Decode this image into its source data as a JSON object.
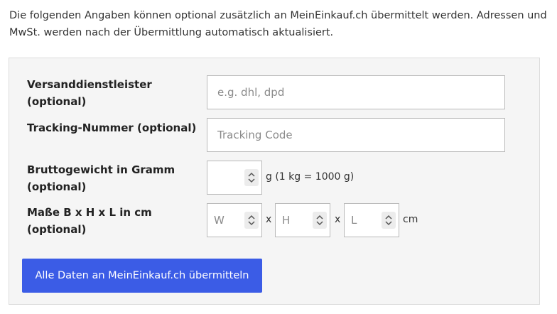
{
  "intro_text": "Die folgenden Angaben können optional zusätzlich an MeinEinkauf.ch übermittelt werden. Adressen und MwSt. werden nach der Übermittlung automatisch aktualisiert.",
  "form": {
    "carrier": {
      "label_line1": "Versanddienstleister",
      "label_line2": "(optional)",
      "value": "",
      "placeholder": "e.g. dhl, dpd"
    },
    "tracking": {
      "label": "Tracking-Nummer (optional)",
      "value": "",
      "placeholder": "Tracking Code"
    },
    "weight": {
      "label_line1": "Bruttogewicht in Gramm",
      "label_line2": "(optional)",
      "value": "",
      "placeholder": "",
      "unit": "g (1 kg = 1000 g)"
    },
    "dimensions": {
      "label_line1": "Maße B x H x L in cm",
      "label_line2": "(optional)",
      "width_placeholder": "W",
      "height_placeholder": "H",
      "length_placeholder": "L",
      "separator": "x",
      "unit": "cm"
    },
    "submit_label": "Alle Daten an MeinEinkauf.ch übermitteln"
  },
  "icons": {
    "spinner": "up-down-chevron-icon"
  }
}
